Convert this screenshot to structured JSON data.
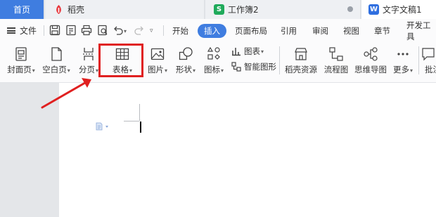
{
  "tabs": {
    "home": "首页",
    "daoke": {
      "label": "稻壳",
      "icon": "daoke-logo-icon",
      "color": "#e8383d"
    },
    "sheet": {
      "label": "工作簿2",
      "icon": "spreadsheet-icon",
      "color": "#1faa5b",
      "glyph": "S"
    },
    "doc": {
      "label": "文字文稿1",
      "icon": "writer-doc-icon",
      "color": "#2f6fe0",
      "glyph": "W"
    }
  },
  "menubar": {
    "file": "文件",
    "items": [
      "开始",
      "插入",
      "页面布局",
      "引用",
      "审阅",
      "视图",
      "章节",
      "开发工具"
    ],
    "active": "插入"
  },
  "ribbon": {
    "cover": "封面页",
    "blank": "空白页",
    "pagebreak": "分页",
    "table": "表格",
    "picture": "图片",
    "shape": "形状",
    "icon": "图标",
    "chart": "图表",
    "smartart": "智能图形",
    "daoke_res": "稻壳资源",
    "flowchart": "流程图",
    "mindmap": "思维导图",
    "more": "更多",
    "comment": "批注"
  },
  "colors": {
    "accent": "#3f7de0",
    "highlight": "#e02020"
  }
}
